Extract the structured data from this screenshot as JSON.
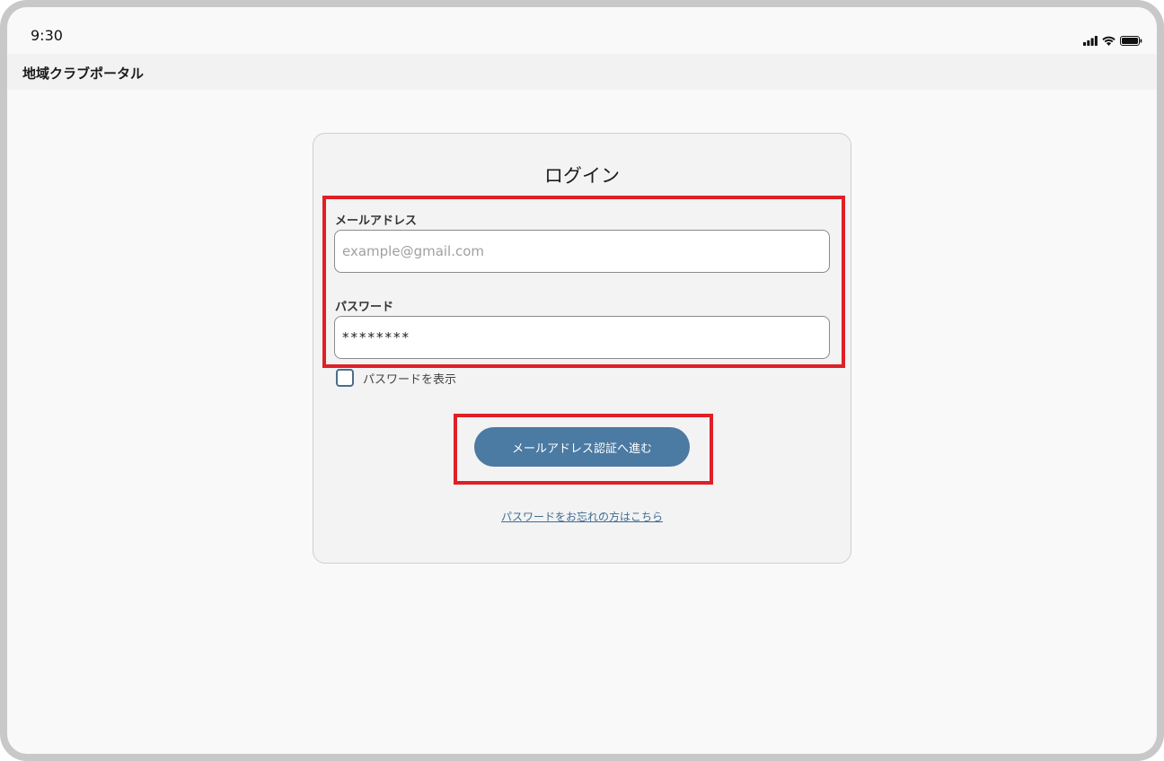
{
  "status_bar": {
    "time": "9:30",
    "icons": [
      "signal-icon",
      "wifi-icon",
      "battery-icon"
    ]
  },
  "app_bar": {
    "title": "地域クラブポータル"
  },
  "login_card": {
    "title": "ログイン",
    "email": {
      "label": "メールアドレス",
      "value": "",
      "placeholder": "example@gmail.com"
    },
    "password": {
      "label": "パスワード",
      "value": "********",
      "placeholder": ""
    },
    "show_password": {
      "label": "パスワードを表示",
      "checked": false
    },
    "submit_label": "メールアドレス認証へ進む",
    "forgot_link": "パスワードをお忘れの方はこちら"
  },
  "colors": {
    "highlight": "#e01f26",
    "primary_button": "#4b7aa2",
    "link": "#3f6c93",
    "checkbox_border": "#4a6d8f"
  }
}
